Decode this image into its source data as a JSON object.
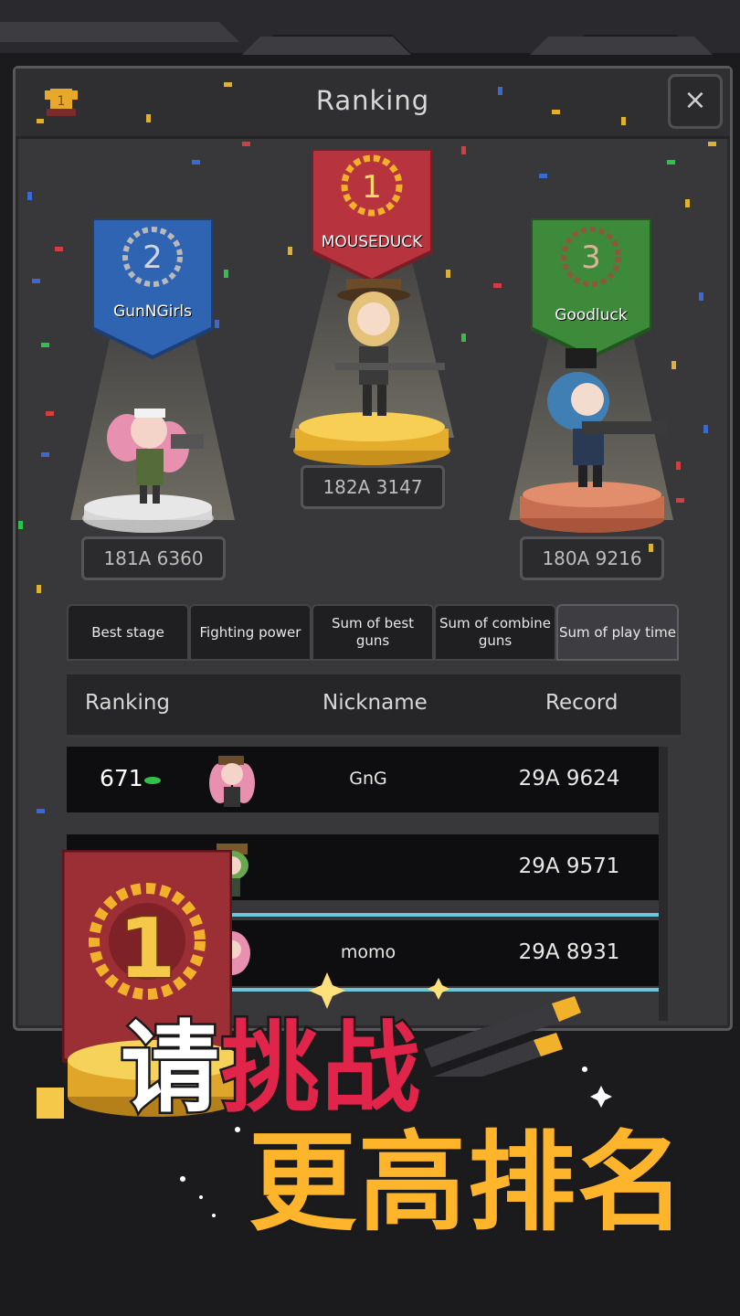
{
  "header": {
    "title": "Ranking",
    "close_label": "×"
  },
  "podium": [
    {
      "place": "2",
      "name": "GunNGirls",
      "score": "181A 6360",
      "color": "#2f64b3"
    },
    {
      "place": "1",
      "name": "MOUSEDUCK",
      "score": "182A 3147",
      "color": "#b7343f"
    },
    {
      "place": "3",
      "name": "Goodluck",
      "score": "180A 9216",
      "color": "#3d8a3a"
    }
  ],
  "tabs": [
    {
      "label": "Best stage"
    },
    {
      "label": "Fighting power"
    },
    {
      "label": "Sum of best guns"
    },
    {
      "label": "Sum of combine guns"
    },
    {
      "label": "Sum of play time"
    }
  ],
  "table": {
    "headers": {
      "rank": "Ranking",
      "nickname": "Nickname",
      "record": "Record"
    },
    "rows": [
      {
        "rank": "671",
        "nickname": "GnG",
        "record": "29A 9624"
      },
      {
        "rank": "",
        "nickname": "",
        "record": "29A 9571"
      },
      {
        "rank": "",
        "nickname": "momo",
        "record": "29A 8931"
      }
    ]
  },
  "promo": {
    "line1_white": "请",
    "line1_red": "挑战",
    "line2": "更高排名",
    "badge_number": "1"
  },
  "colors": {
    "gold": "#f2b12b",
    "red_banner": "#9c2f36",
    "blue_banner": "#2f64b3",
    "green_banner": "#3d8a3a",
    "accent_cyan": "#6fc6d8"
  }
}
